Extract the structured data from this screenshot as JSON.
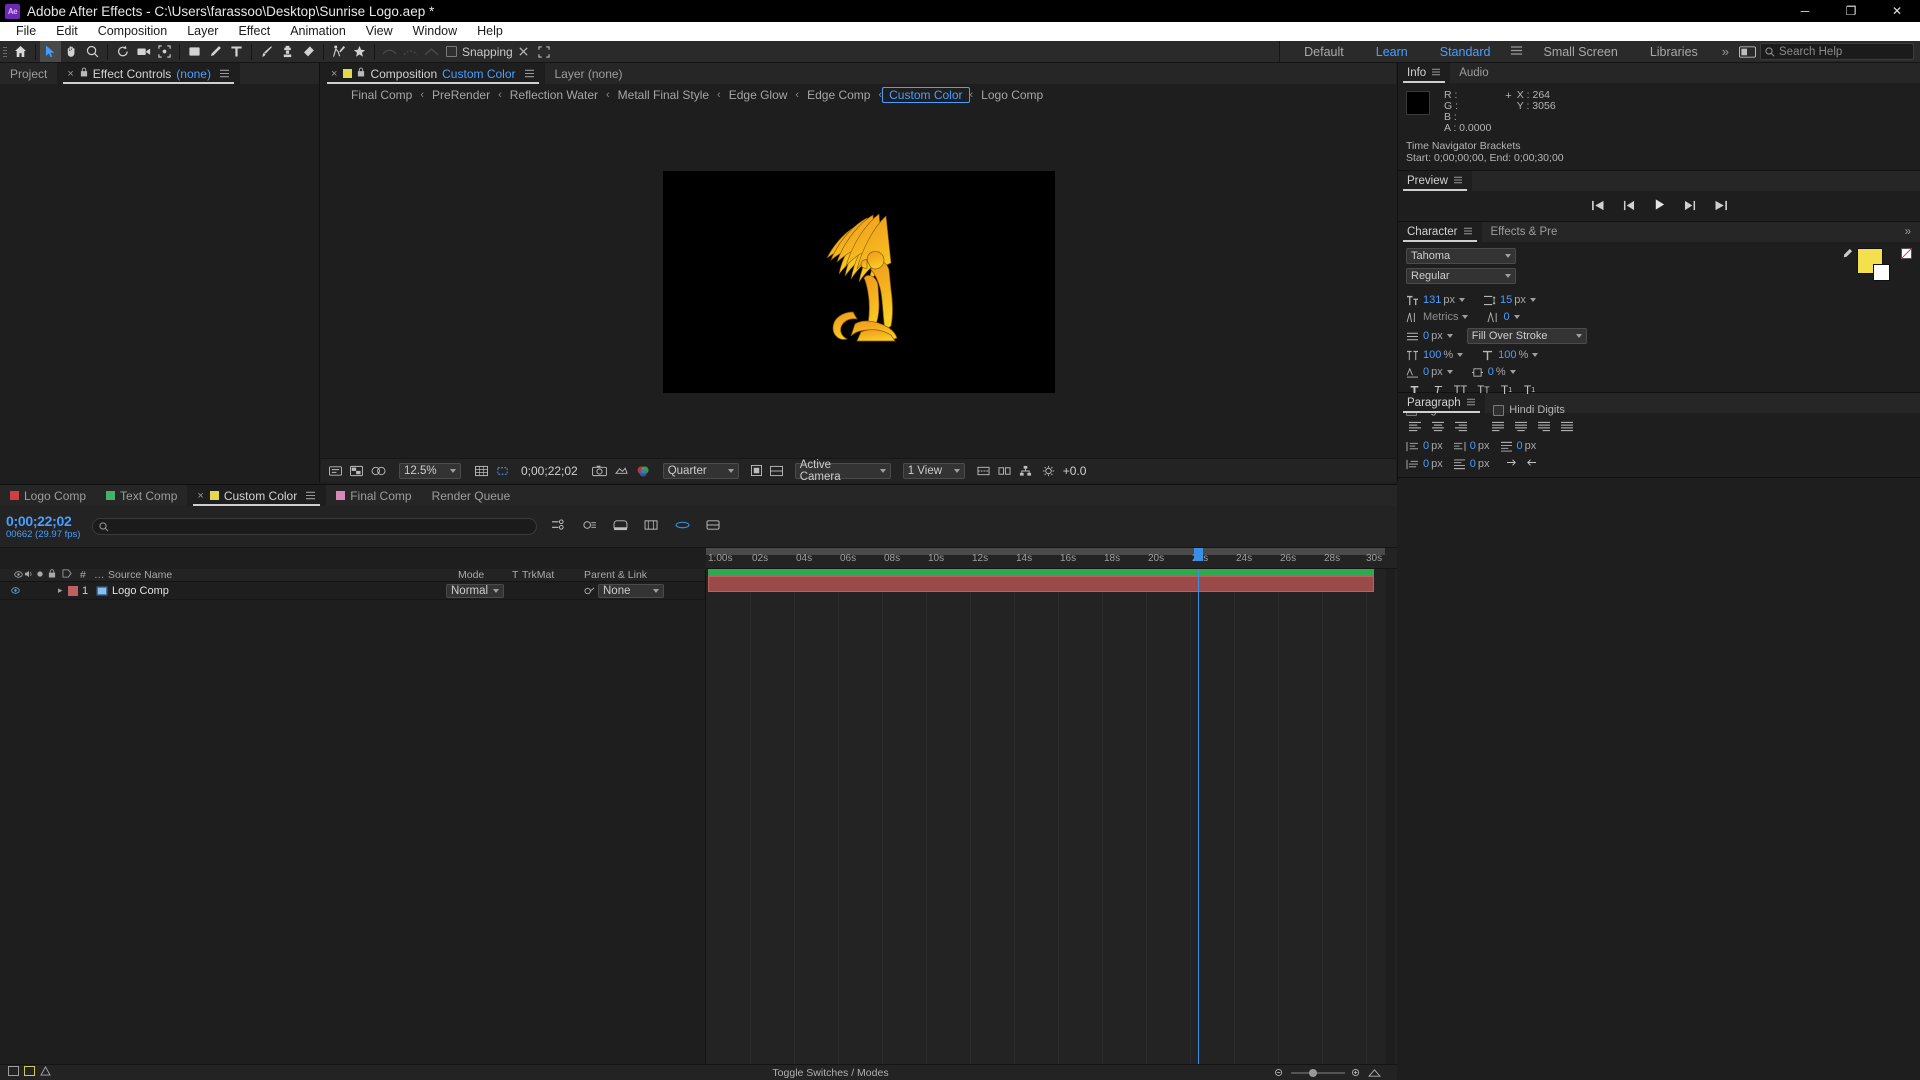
{
  "window": {
    "app_badge": "Ae",
    "title": "Adobe After Effects - C:\\Users\\farassoo\\Desktop\\Sunrise Logo.aep *",
    "minimize": "─",
    "maximize": "❐",
    "close": "✕"
  },
  "menubar": {
    "items": [
      "File",
      "Edit",
      "Composition",
      "Layer",
      "Effect",
      "Animation",
      "View",
      "Window",
      "Help"
    ]
  },
  "toolbar": {
    "snapping_label": "Snapping",
    "workspaces": [
      "Default",
      "Learn",
      "Standard",
      "Small Screen",
      "Libraries"
    ],
    "selected_workspace": "Standard",
    "overflow_chevron": "»",
    "search_placeholder": "Search Help"
  },
  "project_panel": {
    "tabs": [
      {
        "label": "Project",
        "closable": false,
        "active": false,
        "locked": false
      },
      {
        "label": "Effect Controls",
        "suffix": "(none)",
        "closable": true,
        "active": true,
        "locked": true
      }
    ]
  },
  "comp_panel": {
    "tabs": [
      {
        "label": "Composition",
        "comp_name": "Custom Color",
        "closable": true,
        "active": true,
        "locked": true
      },
      {
        "label": "Layer (none)",
        "closable": false,
        "active": false,
        "locked": false
      }
    ],
    "breadcrumb": [
      {
        "label": "Final Comp",
        "selected": false
      },
      {
        "label": "PreRender",
        "selected": false
      },
      {
        "label": "Reflection Water",
        "selected": false
      },
      {
        "label": "Metall Final Style",
        "selected": false
      },
      {
        "label": "Edge Glow",
        "selected": false
      },
      {
        "label": "Edge Comp",
        "selected": false
      },
      {
        "label": "Custom Color",
        "selected": true
      },
      {
        "label": "Logo Comp",
        "selected": false
      }
    ],
    "breadcrumb_sep": "‹",
    "viewer_toolbar": {
      "magnification": "12.5%",
      "timecode": "0;00;22;02",
      "resolution": "Quarter",
      "camera": "Active Camera",
      "views": "1 View",
      "exposure": "+0.0"
    }
  },
  "info_panel": {
    "tabs": [
      "Info",
      "Audio"
    ],
    "active_tab": "Info",
    "channels": [
      "R :",
      "G :",
      "B :",
      "A : 0.0000"
    ],
    "x_label": "X : 264",
    "y_label": "Y : 3056",
    "nav_title": "Time Navigator Brackets",
    "nav_value": "Start: 0;00;00;00, End: 0;00;30;00"
  },
  "preview_panel": {
    "title": "Preview",
    "buttons": [
      "first-frame",
      "previous-frame",
      "play",
      "next-frame",
      "last-frame"
    ]
  },
  "character_panel": {
    "tabs": [
      "Character",
      "Effects & Pre"
    ],
    "active_tab": "Character",
    "font_family": "Tahoma",
    "font_style": "Regular",
    "font_size": "131",
    "font_size_unit": "px",
    "leading": "15",
    "leading_unit": "px",
    "kerning_label": "Metrics",
    "tracking": "0",
    "stroke_width": "0",
    "stroke_width_unit": "px",
    "stroke_mode": "Fill Over Stroke",
    "vertical_scale": "100",
    "vertical_scale_unit": "%",
    "horizontal_scale": "100",
    "horizontal_scale_unit": "%",
    "baseline_shift": "0",
    "baseline_shift_unit": "px",
    "tsume": "0",
    "tsume_unit": "%",
    "fill_color": "#f4e04d",
    "stroke_color": "#ffffff",
    "style_buttons": [
      "Faux Bold",
      "Faux Italic",
      "All Caps",
      "Small Caps",
      "Superscript",
      "Subscript"
    ],
    "ligatures_label": "Ligatures",
    "hindi_label": "Hindi Digits"
  },
  "paragraph_panel": {
    "title": "Paragraph",
    "indent_left": "0",
    "indent_right": "0",
    "indent_first": "0",
    "space_before": "0",
    "space_after": "0",
    "unit": "px"
  },
  "timeline": {
    "tabs": [
      {
        "label": "Logo Comp",
        "color": "red",
        "active": false,
        "closable": false
      },
      {
        "label": "Text Comp",
        "color": "green",
        "active": false,
        "closable": false
      },
      {
        "label": "Custom Color",
        "color": "yellow",
        "active": true,
        "closable": true
      },
      {
        "label": "Final Comp",
        "color": "pink",
        "active": false,
        "closable": false
      },
      {
        "label": "Render Queue",
        "color": "none",
        "active": false,
        "closable": false
      }
    ],
    "current_time": "0;00;22;02",
    "frame_info": "00662 (29.97 fps)",
    "search_placeholder": "",
    "columns": [
      "#",
      "Source Name",
      "Mode",
      "T",
      "TrkMat",
      "Parent & Link"
    ],
    "layers": [
      {
        "index": "1",
        "name": "Logo Comp",
        "mode": "Normal",
        "trkmat": "",
        "parent": "None",
        "color": "#c05f5f",
        "visible": true
      }
    ],
    "ruler_ticks": [
      "1:00s",
      "02s",
      "04s",
      "06s",
      "08s",
      "10s",
      "12s",
      "14s",
      "16s",
      "18s",
      "20s",
      "22s",
      "24s",
      "26s",
      "28s",
      "30s"
    ],
    "toggle_switches_label": "Toggle Switches / Modes"
  }
}
